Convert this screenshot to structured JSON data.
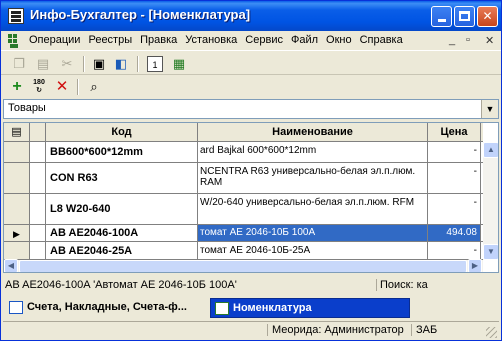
{
  "window": {
    "title": "Инфо-Бухгалтер - [Номенклатура]"
  },
  "menu": {
    "items": [
      "Операции",
      "Реестры",
      "Правка",
      "Установка",
      "Сервис",
      "Файл",
      "Окно",
      "Справка"
    ]
  },
  "toolbar": {
    "row1_icons": [
      "copy-icon",
      "paste-icon",
      "cut-icon",
      "print-icon",
      "preview-icon",
      "calendar-icon",
      "calculator-icon"
    ],
    "row2_icons": [
      "add-icon",
      "rotate-icon",
      "delete-icon",
      "find-icon"
    ],
    "rotate_badge": "180"
  },
  "filter": {
    "value": "Товары"
  },
  "grid": {
    "columns": [
      "Код",
      "Наименование",
      "Цена"
    ],
    "rows": [
      {
        "code": "BB600*600*12mm",
        "name": "ard Bajkal 600*600*12mm",
        "price": "-"
      },
      {
        "code": "CON R63",
        "name": "NCENTRA R63 универсально-белая эл.п.люм. RAM",
        "price": "-"
      },
      {
        "code": "L8 W20-640",
        "name": "W/20-640 универсально-белая эл.п.люм. RFM",
        "price": "-"
      },
      {
        "code": "AB AE2046-100A",
        "name": "томат АЕ 2046-10Б 100А",
        "price": "494.08",
        "selected": true
      },
      {
        "code": "AB AE2046-25A",
        "name": "томат АЕ 2046-10Б-25А",
        "price": "-"
      }
    ]
  },
  "status": {
    "current": "AB AE2046-100A 'Автомат АЕ 2046-10Б 100А'",
    "search": "Поиск: ка"
  },
  "tasks": [
    {
      "label": "Счета, Накладные, Счета-ф...",
      "active": false
    },
    {
      "label": "Номенклатура",
      "active": true
    }
  ],
  "footer": {
    "user": "Меорида: Администратор",
    "lang": "ЗАБ"
  }
}
